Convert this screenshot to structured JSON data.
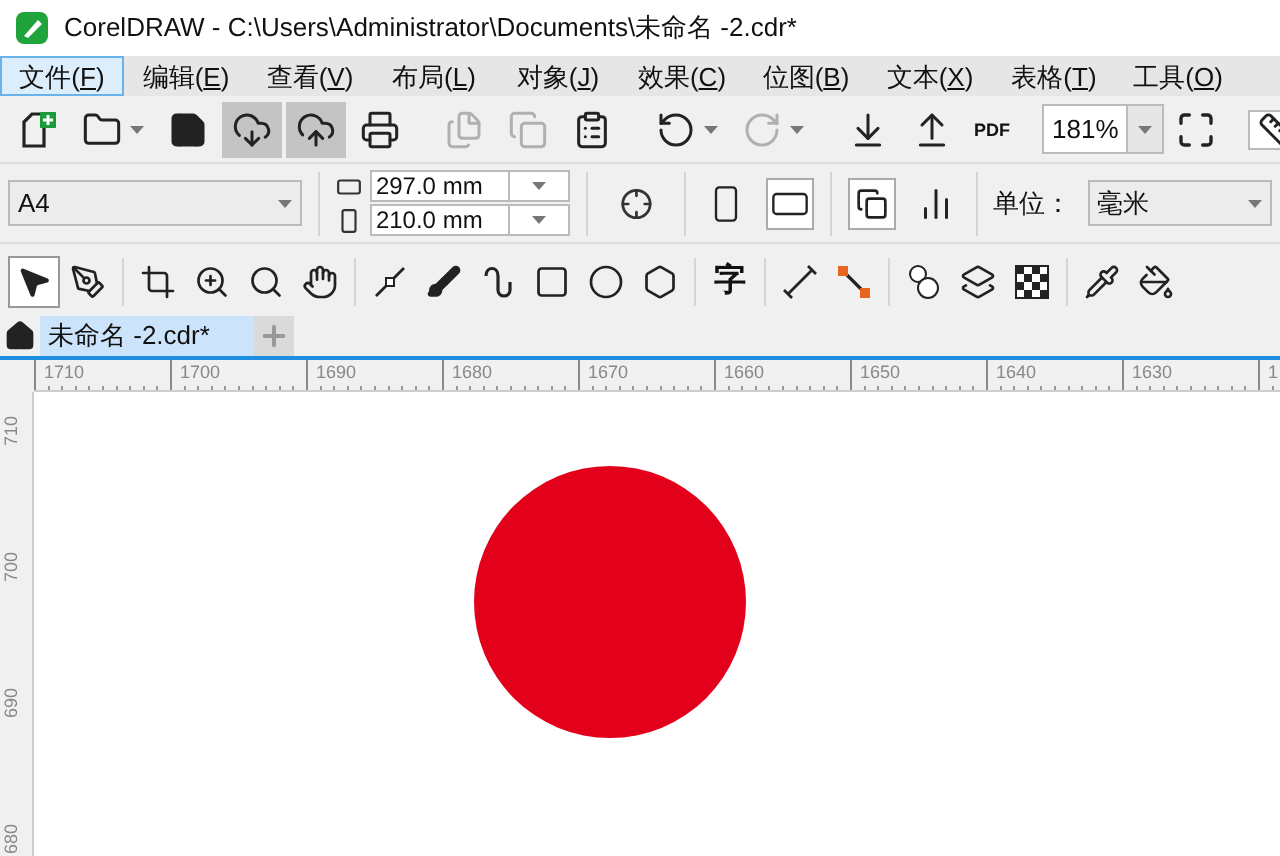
{
  "window": {
    "title": "CorelDRAW - C:\\Users\\Administrator\\Documents\\未命名 -2.cdr*"
  },
  "menu": [
    {
      "label": "文件(F)",
      "selected": true
    },
    {
      "label": "编辑(E)",
      "selected": false
    },
    {
      "label": "查看(V)",
      "selected": false
    },
    {
      "label": "布局(L)",
      "selected": false
    },
    {
      "label": "对象(J)",
      "selected": false
    },
    {
      "label": "效果(C)",
      "selected": false
    },
    {
      "label": "位图(B)",
      "selected": false
    },
    {
      "label": "文本(X)",
      "selected": false
    },
    {
      "label": "表格(T)",
      "selected": false
    },
    {
      "label": "工具(O)",
      "selected": false
    }
  ],
  "standard_toolbar": [
    {
      "active": false,
      "disabled": false
    },
    {
      "active": false,
      "disabled": false
    },
    {
      "active": false,
      "disabled": false
    },
    {
      "active": true,
      "disabled": false
    },
    {
      "active": true,
      "disabled": false
    },
    {
      "active": false,
      "disabled": false
    },
    {
      "active": false,
      "disabled": true
    },
    {
      "active": false,
      "disabled": true
    },
    {
      "active": false,
      "disabled": false
    },
    {
      "active": false,
      "disabled": false
    },
    {
      "active": false,
      "disabled": true
    },
    {
      "active": false,
      "disabled": false
    },
    {
      "active": false,
      "disabled": false
    }
  ],
  "pdf_label": "PDF",
  "zoom": {
    "value": "181%"
  },
  "property_bar": {
    "page_size": {
      "value": "A4"
    },
    "width": {
      "value": "297.0 mm"
    },
    "height": {
      "value": "210.0 mm"
    },
    "orientation": [
      {
        "selected": false
      },
      {
        "selected": true
      }
    ],
    "page_layout": [
      {
        "selected": true
      },
      {
        "selected": false
      }
    ],
    "unit_label": "单位：",
    "units": {
      "value": "毫米"
    }
  },
  "toolbox": [
    {
      "selected": true
    },
    {
      "selected": false
    },
    {
      "selected": false
    },
    {
      "selected": false
    },
    {
      "selected": false
    },
    {
      "selected": false
    },
    {
      "selected": false
    },
    {
      "selected": false
    },
    {
      "selected": false
    },
    {
      "selected": false
    },
    {
      "selected": false
    },
    {
      "selected": false
    },
    {
      "selected": false,
      "glyph": "字"
    },
    {
      "selected": false
    },
    {
      "selected": false
    },
    {
      "selected": false
    },
    {
      "selected": false
    },
    {
      "selected": false
    },
    {
      "selected": false
    },
    {
      "selected": false
    }
  ],
  "tabs": [
    {
      "label": "未命名 -2.cdr*",
      "selected": true
    }
  ],
  "horizontal_ruler": [
    "1710",
    "1700",
    "1690",
    "1680",
    "1670",
    "1660",
    "1650",
    "1640",
    "1630",
    "1"
  ],
  "vertical_ruler": [
    "710",
    "700",
    "690",
    "680"
  ]
}
